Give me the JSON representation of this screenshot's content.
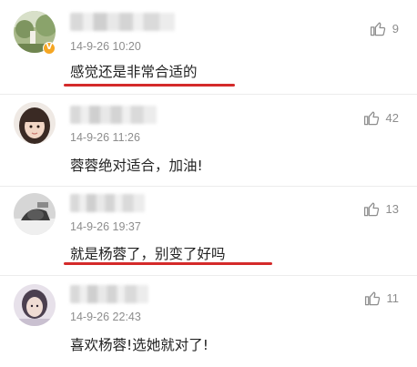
{
  "comments": [
    {
      "timestamp": "14-9-26 10:20",
      "text": "感觉还是非常合适的",
      "likes": "9",
      "avatar_icon": "avatar-landscape-photo",
      "verified_badge": "V"
    },
    {
      "timestamp": "14-9-26 11:26",
      "text": "蓉蓉绝对适合，加油!",
      "likes": "42",
      "avatar_icon": "avatar-girl-photo"
    },
    {
      "timestamp": "14-9-26 19:37",
      "text": "就是杨蓉了，别变了好吗",
      "likes": "13",
      "avatar_icon": "avatar-bw-photo"
    },
    {
      "timestamp": "14-9-26 22:43",
      "text": "喜欢杨蓉!选她就对了!",
      "likes": "11",
      "avatar_icon": "avatar-portrait-photo"
    }
  ],
  "colors": {
    "highlight_underline": "#d42a2a",
    "meta_text": "#8d8d8d",
    "verified_badge": "#f5a623"
  },
  "icons": {
    "like": "thumbs-up-icon"
  }
}
